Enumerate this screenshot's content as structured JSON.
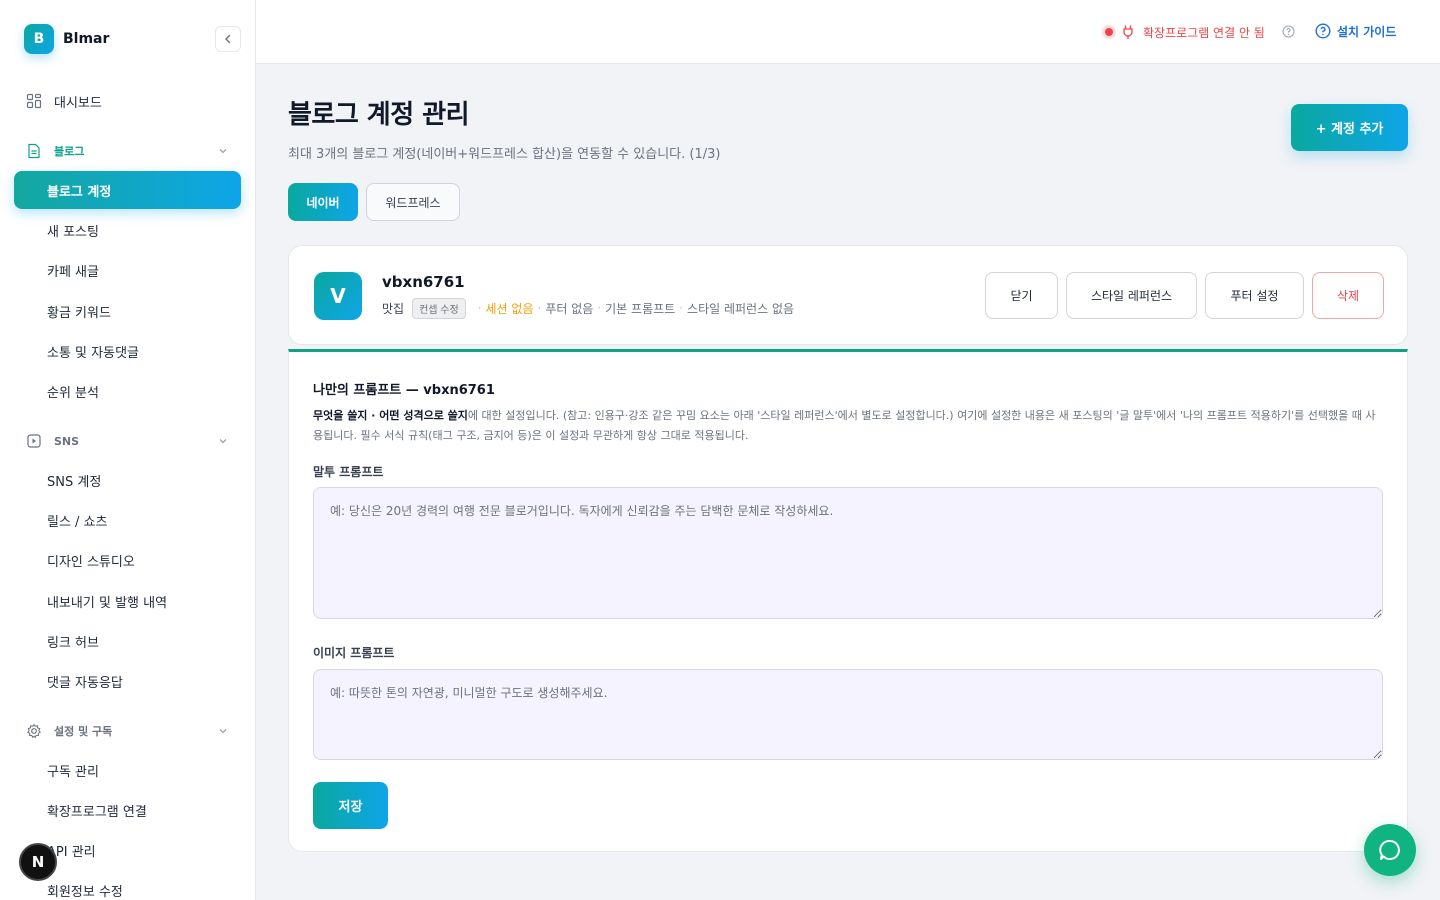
{
  "brand": {
    "logo_letter": "B",
    "name": "Blmar"
  },
  "sidebar": {
    "dashboard": "대시보드",
    "blog_section": "블로그",
    "blog_items": [
      "블로그 계정",
      "새 포스팅",
      "카페 새글",
      "황금 키워드",
      "소통 및 자동댓글",
      "순위 분석"
    ],
    "sns_section": "SNS",
    "sns_items": [
      "SNS 계정",
      "릴스 / 쇼츠",
      "디자인 스튜디오",
      "내보내기 및 발행 내역",
      "링크 허브",
      "댓글 자동응답"
    ],
    "settings_section": "설정 및 구독",
    "settings_items": [
      "구독 관리",
      "확장프로그램 연결",
      "API 관리",
      "회원정보 수정"
    ],
    "n_badge": "N"
  },
  "topbar": {
    "extension_status": "확장프로그램 연결 안 됨",
    "install_guide": "설치 가이드"
  },
  "main": {
    "title": "블로그 계정 관리",
    "description": "최대 3개의 블로그 계정(네이버+워드프레스 합산)을 연동할 수 있습니다. (1/3)",
    "add_button": "+ 계정 추가",
    "tabs": [
      {
        "label": "네이버",
        "active": true
      },
      {
        "label": "워드프레스",
        "active": false
      }
    ]
  },
  "account": {
    "avatar_letter": "V",
    "name": "vbxn6761",
    "category": "맛집",
    "concept_button": "컨셉 수정",
    "session": "세션 없음",
    "footer": "푸터 없음",
    "prompt": "기본 프롬프트",
    "style_ref": "스타일 레퍼런스 없음",
    "separator": "·",
    "buttons": {
      "close": "닫기",
      "style_reference": "스타일 레퍼런스",
      "footer_settings": "푸터 설정",
      "delete": "삭제"
    }
  },
  "prompt_panel": {
    "title": "나만의 프롬프트 — vbxn6761",
    "desc_bold": "무엇을 쓸지 · 어떤 성격으로 쓸지",
    "desc_rest": "에 대한 설정입니다. (참고: 인용구·강조 같은 꾸밈 요소는 아래 '스타일 레퍼런스'에서 별도로 설정합니다.) 여기에 설정한 내용은 새 포스팅의 '글 말투'에서 '나의 프롬프트 적용하기'를 선택했을 때 사용됩니다. 필수 서식 규칙(태그 구조, 금지어 등)은 이 설정과 무관하게 항상 그대로 적용됩니다.",
    "tone_label": "말투 프롬프트",
    "tone_placeholder": "예: 당신은 20년 경력의 여행 전문 블로거입니다. 독자에게 신뢰감을 주는 담백한 문체로 작성하세요.",
    "image_label": "이미지 프롬프트",
    "image_placeholder": "예: 따뜻한 톤의 자연광, 미니멀한 구도로 생성해주세요.",
    "save_button": "저장"
  },
  "colors": {
    "accent_start": "#0aa89e",
    "accent_end": "#0ea5e9",
    "danger": "#ef4444",
    "warning": "#f59e0b",
    "link": "#1e6fd9"
  }
}
